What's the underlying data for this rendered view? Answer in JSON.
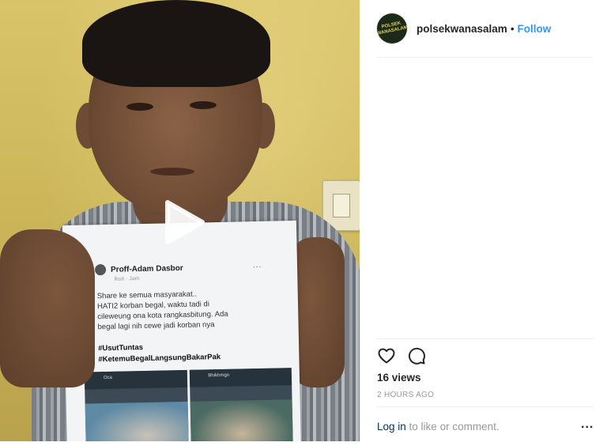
{
  "post": {
    "username": "polsekwanasalam",
    "separator": "•",
    "follow_label": "Follow",
    "avatar_text": "POLSEK WANASALAM",
    "views": "16 views",
    "timestamp": "2 HOURS AGO",
    "login_link": "Log in",
    "login_suffix": " to like or comment.",
    "more_label": "..."
  },
  "media": {
    "paper_author": "Proff-Adam Dasbor",
    "paper_meta": "Ikuti · Jam",
    "paper_more": "...",
    "paper_body": "Share ke semua masyarakat..\nHATI2 korban begal, waktu tadi di\ncileweung ona kota rangkasbitung. Ada\nbegal lagi nih cewe jadi korban nya",
    "paper_tags": "#UsutTuntas\n#KetemuBegalLangsungBakarPak",
    "thumb_left_name": "Oca",
    "thumb_right_name": "Bhikhmgn"
  },
  "icons": {
    "play": "play-icon",
    "like": "heart-icon",
    "comment": "comment-icon",
    "more": "more-options-icon"
  },
  "colors": {
    "follow": "#3897f0",
    "login_link": "#003569",
    "muted": "#999999",
    "text": "#262626"
  }
}
